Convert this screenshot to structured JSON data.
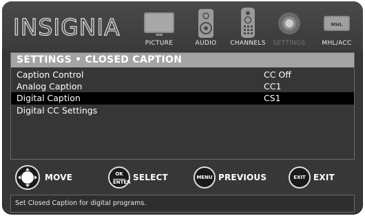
{
  "brand": "INSIGNIA",
  "nav": [
    {
      "label": "PICTURE",
      "icon": "tv-icon",
      "active": false
    },
    {
      "label": "AUDIO",
      "icon": "speaker-icon",
      "active": false
    },
    {
      "label": "CHANNELS",
      "icon": "remote-icon",
      "active": false
    },
    {
      "label": "SETTINGS",
      "icon": "gear-icon",
      "active": true
    },
    {
      "label": "MHL/ACC",
      "icon": "mhl-icon",
      "active": false,
      "badge": "MHL"
    }
  ],
  "panel": {
    "title": "SETTINGS • CLOSED CAPTION",
    "rows": [
      {
        "label": "Caption Control",
        "value": "CC Off",
        "selected": false
      },
      {
        "label": "Analog Caption",
        "value": "CC1",
        "selected": false
      },
      {
        "label": "Digital Caption",
        "value": "CS1",
        "selected": true
      },
      {
        "label": "Digital CC Settings",
        "value": "",
        "selected": false
      }
    ]
  },
  "hints": [
    {
      "button": "",
      "label": "MOVE",
      "icon": "dpad-icon"
    },
    {
      "button_top": "OK",
      "button_bottom": "ENTER",
      "label": "SELECT",
      "icon": "ok-enter-button-icon"
    },
    {
      "button": "MENU",
      "label": "PREVIOUS",
      "icon": "menu-button-icon"
    },
    {
      "button": "EXIT",
      "label": "EXIT",
      "icon": "exit-button-icon"
    }
  ],
  "status_text": "Set Closed Caption for digital programs.",
  "colors": {
    "background": "#373737",
    "title_bar": "#a4a4a4",
    "selected_row": "#000000",
    "text": "#ffffff"
  }
}
